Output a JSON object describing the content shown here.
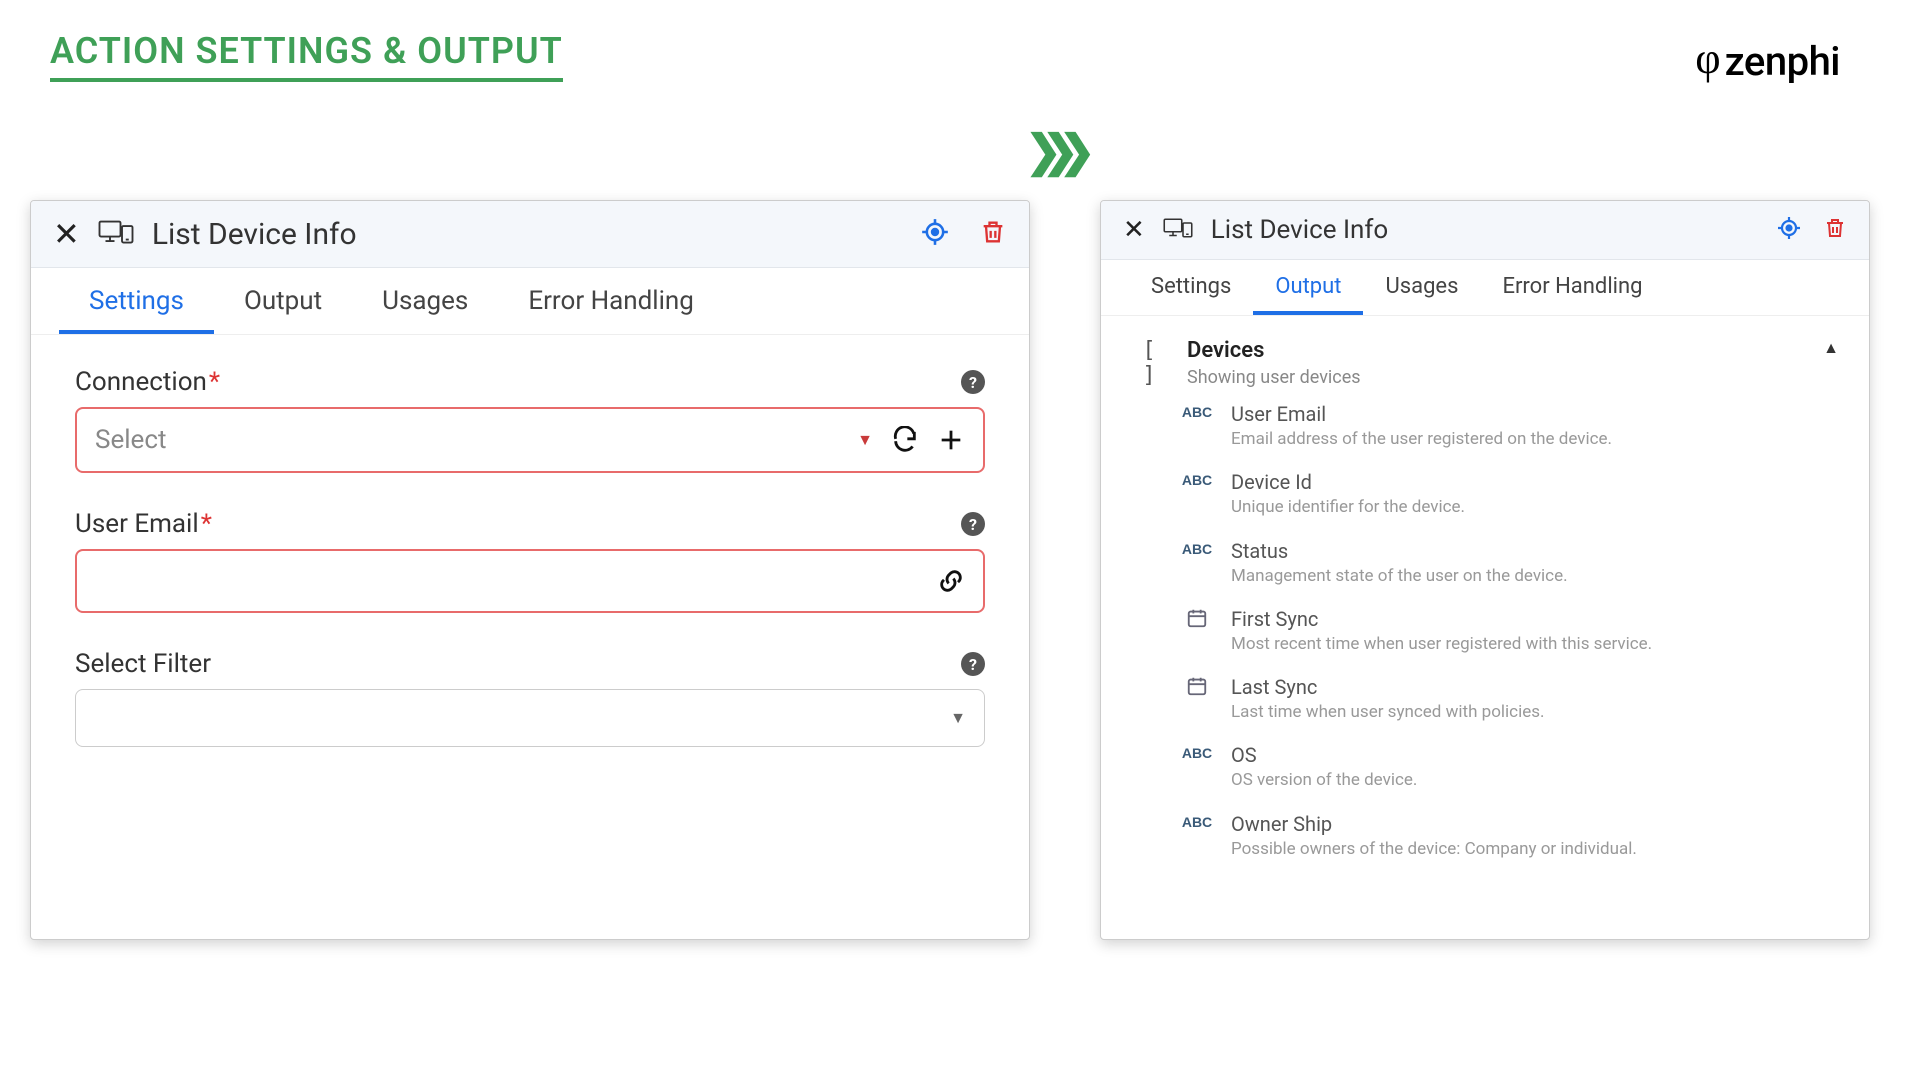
{
  "page_title": "ACTION SETTINGS & OUTPUT",
  "brand": {
    "symbol": "φ",
    "name": "zenphi"
  },
  "left_panel": {
    "title": "List Device Info",
    "tabs": [
      "Settings",
      "Output",
      "Usages",
      "Error Handling"
    ],
    "active_tab_index": 0,
    "fields": {
      "connection": {
        "label": "Connection",
        "required": true,
        "placeholder": "Select"
      },
      "user_email": {
        "label": "User Email",
        "required": true
      },
      "select_filter": {
        "label": "Select Filter",
        "required": false
      }
    }
  },
  "right_panel": {
    "title": "List Device Info",
    "tabs": [
      "Settings",
      "Output",
      "Usages",
      "Error Handling"
    ],
    "active_tab_index": 1,
    "section": {
      "title": "Devices",
      "subtitle": "Showing user devices",
      "type_indicator": "[ ]"
    },
    "items": [
      {
        "type": "ABC",
        "title": "User Email",
        "desc": "Email address of the user registered on the device."
      },
      {
        "type": "ABC",
        "title": "Device Id",
        "desc": "Unique identifier for the device."
      },
      {
        "type": "ABC",
        "title": "Status",
        "desc": "Management state of the user on the device."
      },
      {
        "type": "DATE",
        "title": "First Sync",
        "desc": "Most recent time when user registered with this service."
      },
      {
        "type": "DATE",
        "title": "Last Sync",
        "desc": "Last time when user synced with policies."
      },
      {
        "type": "ABC",
        "title": "OS",
        "desc": "OS version of the device."
      },
      {
        "type": "ABC",
        "title": "Owner Ship",
        "desc": "Possible owners of the device: Company or individual."
      }
    ]
  }
}
